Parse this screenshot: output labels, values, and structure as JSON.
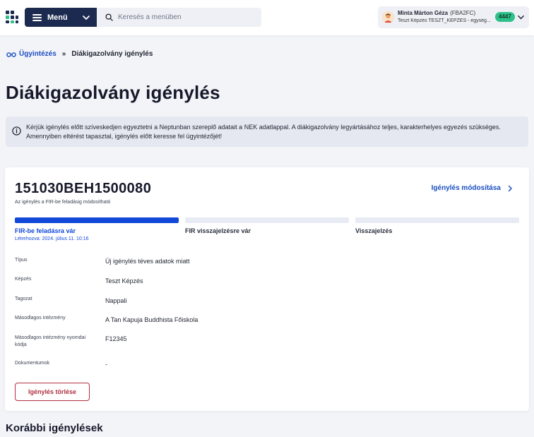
{
  "header": {
    "menu_label": "Menü",
    "search_placeholder": "Keresés a menüben",
    "user": {
      "name": "Minta Márton Géza",
      "code": "(FBA2FC)",
      "subtitle": "Teszt Képzés TESZT_KEPZES - egység...",
      "badge": "4447"
    }
  },
  "breadcrumb": {
    "parent": "Ügyintézés",
    "separator": "»",
    "current": "Diákigazolvány igénylés"
  },
  "page": {
    "title": "Diákigazolvány igénylés",
    "info_text": "Kérjük igénylés előtt szíveskedjen egyeztetni a Neptunban szereplő adatait a NEK adatlappal. A diákigazolvány legyártásához teljes, karakterhelyes egyezés szükséges. Amennyiben eltérést tapasztal, igénylés előtt keresse fel ügyintézőjét!"
  },
  "request": {
    "id": "151030BEH1500080",
    "note": "Az igénylés a FIR-be feladásig módosítható",
    "modify_label": "Igénylés módosítása",
    "steps": [
      {
        "label": "FIR-be feladásra vár",
        "active": true
      },
      {
        "label": "FIR visszajelzésre vár",
        "active": false
      },
      {
        "label": "Visszajelzés",
        "active": false
      }
    ],
    "created": "Létrehozva: 2024. július 11. 10:16",
    "fields": [
      {
        "label": "Típus",
        "value": "Új igénylés téves adatok miatt"
      },
      {
        "label": "Képzés",
        "value": "Teszt Képzés"
      },
      {
        "label": "Tagozat",
        "value": "Nappali"
      },
      {
        "label": "Másodlagos intézmény",
        "value": "A Tan Kapuja Buddhista Főiskola"
      },
      {
        "label": "Másodlagos intézmény nyomdai kódja",
        "value": "F12345"
      },
      {
        "label": "Dokumentumok",
        "value": "-"
      }
    ],
    "delete_label": "Igénylés törlése"
  },
  "previous_section_title": "Korábbi igénylések",
  "colors": {
    "primary_blue": "#1148d8",
    "menu_dark": "#1c2a4f",
    "badge_green": "#2ec08a",
    "danger_red": "#b03040"
  }
}
